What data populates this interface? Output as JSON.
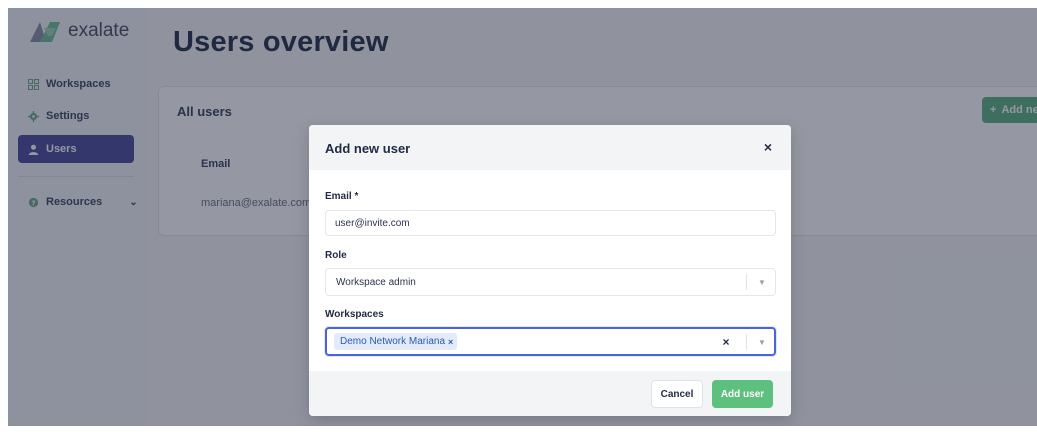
{
  "app": {
    "logo_text": "exalate",
    "page_title": "Users overview"
  },
  "sidebar": {
    "items": [
      {
        "label": "Workspaces",
        "icon": "workspaces-icon"
      },
      {
        "label": "Settings",
        "icon": "gear-icon"
      },
      {
        "label": "Users",
        "icon": "user-icon",
        "active": true
      },
      {
        "label": "Resources",
        "icon": "resources-icon",
        "has_dropdown": true
      }
    ]
  },
  "users_card": {
    "title": "All users",
    "add_button_label": "Add ne",
    "column_header": "Email",
    "rows": [
      {
        "email": "mariana@exalate.com"
      }
    ]
  },
  "modal": {
    "title": "Add new user",
    "email": {
      "label": "Email *",
      "value": "user@invite.com"
    },
    "role": {
      "label": "Role",
      "selected": "Workspace admin"
    },
    "workspaces": {
      "label": "Workspaces",
      "chips": [
        "Demo Network Mariana"
      ],
      "chip_remove": "×"
    },
    "close_symbol": "×",
    "clear_symbol": "×",
    "cancel_label": "Cancel",
    "submit_label": "Add user"
  },
  "colors": {
    "brand_purple": "#4a4c9a",
    "success_green": "#5ec07f",
    "focus_blue": "#4d65d4",
    "chip_bg": "#e3ebfb"
  }
}
